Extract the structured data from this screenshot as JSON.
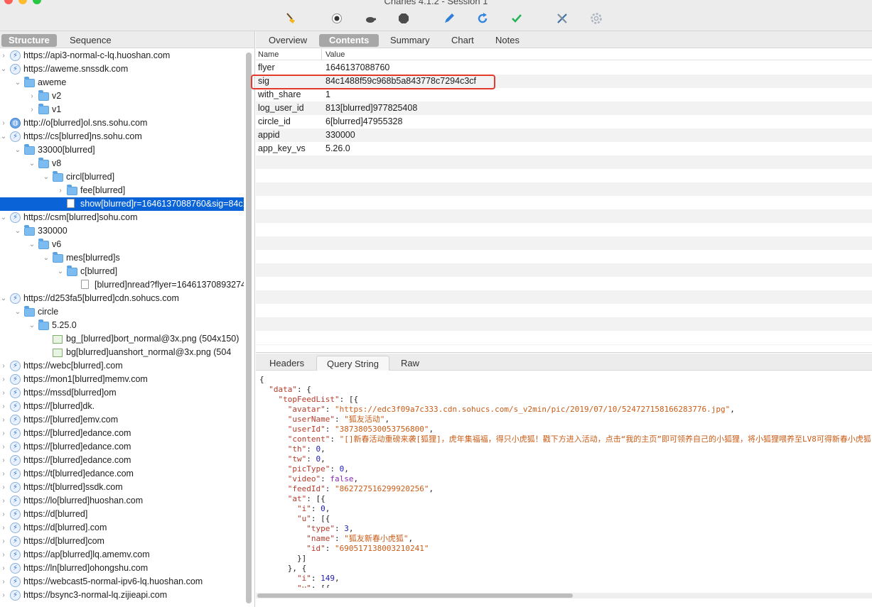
{
  "window": {
    "title": "Charles 4.1.2 - Session 1"
  },
  "toolbar": {
    "tools": [
      "broom-icon",
      "record-icon",
      "turtle-icon",
      "stop-icon",
      "pen-icon",
      "refresh-icon",
      "check-icon",
      "tools-icon",
      "settings-icon"
    ]
  },
  "left_tabs": [
    "Structure",
    "Sequence"
  ],
  "tree": [
    {
      "label": "https://api3-normal-c-lq.huoshan.com",
      "icon": "bolt",
      "depth": 0,
      "expanded": false
    },
    {
      "label": "https://aweme.snssdk.com",
      "icon": "bolt",
      "depth": 0,
      "expanded": true
    },
    {
      "label": "aweme",
      "icon": "folder",
      "depth": 1,
      "expanded": true
    },
    {
      "label": "v2",
      "icon": "folder",
      "depth": 2,
      "expanded": false
    },
    {
      "label": "v1",
      "icon": "folder",
      "depth": 2,
      "expanded": false
    },
    {
      "label": "http://o[blurred]ol.sns.sohu.com",
      "icon": "globe",
      "depth": 0,
      "expanded": false
    },
    {
      "label": "https://cs[blurred]ns.sohu.com",
      "icon": "bolt",
      "depth": 0,
      "expanded": true
    },
    {
      "label": "33000[blurred]",
      "icon": "folder",
      "depth": 1,
      "expanded": true
    },
    {
      "label": "v8",
      "icon": "folder",
      "depth": 2,
      "expanded": true
    },
    {
      "label": "circl[blurred]",
      "icon": "folder",
      "depth": 3,
      "expanded": true
    },
    {
      "label": "fee[blurred]",
      "icon": "folder",
      "depth": 4,
      "expanded": false
    },
    {
      "label": "show[blurred]r=1646137088760&sig=84c1",
      "icon": "doc",
      "depth": 4,
      "selected": true
    },
    {
      "label": "https://csm[blurred]sohu.com",
      "icon": "bolt",
      "depth": 0,
      "expanded": true
    },
    {
      "label": "330000",
      "icon": "folder",
      "depth": 1,
      "expanded": true
    },
    {
      "label": "v6",
      "icon": "folder",
      "depth": 2,
      "expanded": true
    },
    {
      "label": "mes[blurred]s",
      "icon": "folder",
      "depth": 3,
      "expanded": true
    },
    {
      "label": "c[blurred]",
      "icon": "folder",
      "depth": 4,
      "expanded": true
    },
    {
      "label": "[blurred]nread?flyer=16461370893274",
      "icon": "doc",
      "depth": 5
    },
    {
      "label": "https://d253fa5[blurred]cdn.sohucs.com",
      "icon": "bolt",
      "depth": 0,
      "expanded": true
    },
    {
      "label": "circle",
      "icon": "folder",
      "depth": 1,
      "expanded": true
    },
    {
      "label": "5.25.0",
      "icon": "folder",
      "depth": 2,
      "expanded": true
    },
    {
      "label": "bg_[blurred]bort_normal@3x.png (504x150)",
      "icon": "img",
      "depth": 3
    },
    {
      "label": "bg[blurred]uanshort_normal@3x.png (504",
      "icon": "img",
      "depth": 3
    },
    {
      "label": "https://webc[blurred].com",
      "icon": "bolt",
      "depth": 0,
      "expanded": false
    },
    {
      "label": "https://mon1[blurred]memv.com",
      "icon": "bolt",
      "depth": 0,
      "expanded": false
    },
    {
      "label": "https://mssd[blurred]om",
      "icon": "bolt",
      "depth": 0,
      "expanded": false
    },
    {
      "label": "https://[blurred]dk.",
      "icon": "bolt",
      "depth": 0,
      "expanded": false
    },
    {
      "label": "https://[blurred]emv.com",
      "icon": "bolt",
      "depth": 0,
      "expanded": false
    },
    {
      "label": "https://[blurred]edance.com",
      "icon": "bolt",
      "depth": 0,
      "expanded": false
    },
    {
      "label": "https://[blurred]edance.com",
      "icon": "bolt",
      "depth": 0,
      "expanded": false
    },
    {
      "label": "https://[blurred]edance.com",
      "icon": "bolt",
      "depth": 0,
      "expanded": false
    },
    {
      "label": "https://t[blurred]edance.com",
      "icon": "bolt",
      "depth": 0,
      "expanded": false
    },
    {
      "label": "https://t[blurred]ssdk.com",
      "icon": "bolt",
      "depth": 0,
      "expanded": false
    },
    {
      "label": "https://lo[blurred]huoshan.com",
      "icon": "bolt",
      "depth": 0,
      "expanded": false
    },
    {
      "label": "https://d[blurred]",
      "icon": "bolt",
      "depth": 0,
      "expanded": false
    },
    {
      "label": "https://d[blurred].com",
      "icon": "bolt",
      "depth": 0,
      "expanded": false
    },
    {
      "label": "https://d[blurred]com",
      "icon": "bolt",
      "depth": 0,
      "expanded": false
    },
    {
      "label": "https://ap[blurred]lq.amemv.com",
      "icon": "bolt",
      "depth": 0,
      "expanded": false
    },
    {
      "label": "https://ln[blurred]ohongshu.com",
      "icon": "bolt",
      "depth": 0,
      "expanded": false
    },
    {
      "label": "https://webcast5-normal-ipv6-lq.huoshan.com",
      "icon": "bolt",
      "depth": 0,
      "expanded": false
    },
    {
      "label": "https://bsync3-normal-lq.zijieapi.com",
      "icon": "bolt",
      "depth": 0,
      "expanded": false
    }
  ],
  "right_tabs": [
    "Overview",
    "Contents",
    "Summary",
    "Chart",
    "Notes"
  ],
  "right_tabs_active": "Contents",
  "kv_header": {
    "name": "Name",
    "value": "Value"
  },
  "params": [
    {
      "name": "flyer",
      "value": "1646137088760"
    },
    {
      "name": "sig",
      "value": "84c1488f59c968b5a843778c7294c3cf"
    },
    {
      "name": "with_share",
      "value": "1"
    },
    {
      "name": "log_user_id",
      "value": "813[blurred]977825408"
    },
    {
      "name": "circle_id",
      "value": "6[blurred]47955328"
    },
    {
      "name": "appid",
      "value": "330000"
    },
    {
      "name": "app_key_vs",
      "value": "5.26.0"
    }
  ],
  "bottom_tabs": [
    "Headers",
    "Query String",
    "Raw"
  ],
  "bottom_tabs_active": "Query String",
  "response": {
    "avatar": "https://edc3f09a7c333.cdn.sohucs.com/s_v2min/pic/2019/07/10/524727158166283776.jpg",
    "userName": "狐友活动",
    "userId": "387380530053756800",
    "content": "[]新春活动重磅来袭[狐狸]，虎年集福福，得只小虎狐！戳下方进入活动，点击“我的主页”即可领养自己的小狐狸，将小狐狸喂养至LV8可得新春小虎狐",
    "th": 0,
    "tw": 0,
    "picType": 0,
    "video": false,
    "feedId": "862727516299920256",
    "at_i": 0,
    "u_type": 3,
    "u_name": "狐友新春小虎狐",
    "u_id": "690517138003210241",
    "at2_i": 149
  }
}
